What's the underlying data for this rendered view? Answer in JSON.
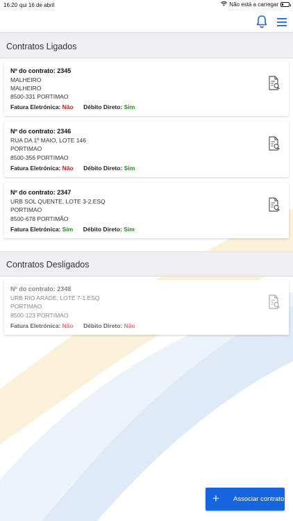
{
  "statusbar": {
    "time": "16:20",
    "date": "qui 16 de abril",
    "network": "Não está a carregar",
    "battery_level": 0.15
  },
  "colors": {
    "accent": "#1565e0",
    "no": "#d11a1a",
    "yes": "#1a8c1a"
  },
  "sections": {
    "connected_title": "Contratos Ligados",
    "disconnected_title": "Contratos Desligados"
  },
  "labels": {
    "invoice": "Fatura Eletrónica:",
    "debit": "Débito Direto:"
  },
  "contracts": [
    {
      "title": "Nº do contrato: 2345",
      "line1": "MALHEIRO",
      "line2": "MALHEIRO",
      "line3": "8500-331 PORTIMAO",
      "invoice": "Não",
      "debit": "Sim"
    },
    {
      "title": "Nº do contrato: 2346",
      "line1": "RUA DA 1º MAIO, LOTE 146",
      "line2": "PORTIMAO",
      "line3": "8500-356 PORTIMAO",
      "invoice": "Não",
      "debit": "Sim"
    },
    {
      "title": "Nº do contrato: 2347",
      "line1": "URB SOL QUENTE, LOTE 3-2.ESQ",
      "line2": "PORTIMAO",
      "line3": "8500-678 PORTIMÃO",
      "invoice": "Sim",
      "debit": "Sim"
    },
    {
      "title": "Nº do contrato: 2348",
      "line1": "URB RIO ARADE, LOTE 7-1.ESQ",
      "line2": "PORTIMAO",
      "line3": "8500-123 PORTIMAO",
      "invoice": "Não",
      "debit": "Não"
    }
  ],
  "fab": {
    "icon": "+",
    "label": "Associar contrato"
  }
}
